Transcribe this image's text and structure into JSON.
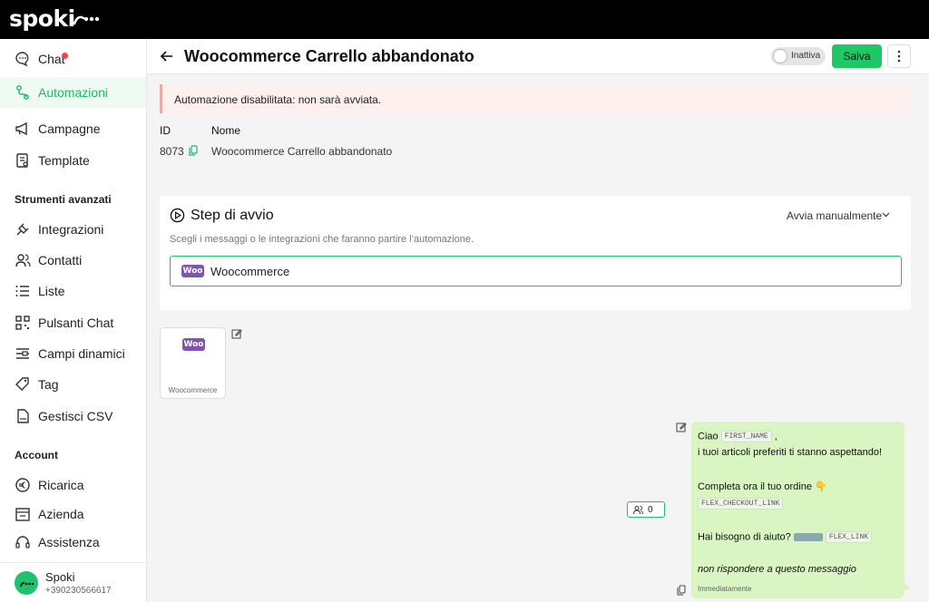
{
  "app": {
    "logo": "spoki"
  },
  "sidebar": {
    "items": [
      {
        "label": "Chat"
      },
      {
        "label": "Automazioni"
      },
      {
        "label": "Campagne"
      },
      {
        "label": "Template"
      },
      {
        "label": "Integrazioni"
      },
      {
        "label": "Contatti"
      },
      {
        "label": "Liste"
      },
      {
        "label": "Pulsanti Chat"
      },
      {
        "label": "Campi dinamici"
      },
      {
        "label": "Tag"
      },
      {
        "label": "Gestisci CSV"
      },
      {
        "label": "Ricarica"
      },
      {
        "label": "Azienda"
      },
      {
        "label": "Assistenza"
      }
    ],
    "sections": {
      "advanced": "Strumenti avanzati",
      "account": "Account"
    },
    "profile": {
      "name": "Spoki",
      "phone": "+390230566617"
    }
  },
  "header": {
    "title": "Woocommerce Carrello abbandonato",
    "toggle_label": "Inattiva",
    "save_label": "Salva"
  },
  "alert": {
    "text": "Automazione disabilitata: non sarà avviata."
  },
  "meta": {
    "id_label": "ID",
    "name_label": "Nome",
    "id_value": "8073",
    "name_value": "Woocommerce Carrello abbandonato"
  },
  "step": {
    "title": "Step di avvio",
    "mode": "Avvia manualmente",
    "subtitle": "Scegli i messaggi o le integrazioni che faranno partire l’automazione.",
    "trigger_name": "Woocommerce",
    "woo_logo": "Woo"
  },
  "node": {
    "label": "Woocommerce",
    "woo_logo": "Woo"
  },
  "counter": {
    "value": "0"
  },
  "message": {
    "greeting": "Ciao",
    "var_first_name": "FIRST_NAME",
    "greeting_suffix": ",",
    "line2": "i tuoi articoli preferiti ti stanno aspettando!",
    "line3": "Completa ora il tuo ordine",
    "line3_emoji": "👇",
    "var_checkout": "FLEX_CHECKOUT_LINK",
    "line4": "Hai bisogno di aiuto?",
    "var_flex": "FLEX_LINK",
    "line5": "non rispondere a questo messaggio",
    "timing": "Immediatamente"
  },
  "colors": {
    "accent": "#1ec864",
    "woo": "#7f54b3",
    "bubble": "#d8f5c2"
  }
}
